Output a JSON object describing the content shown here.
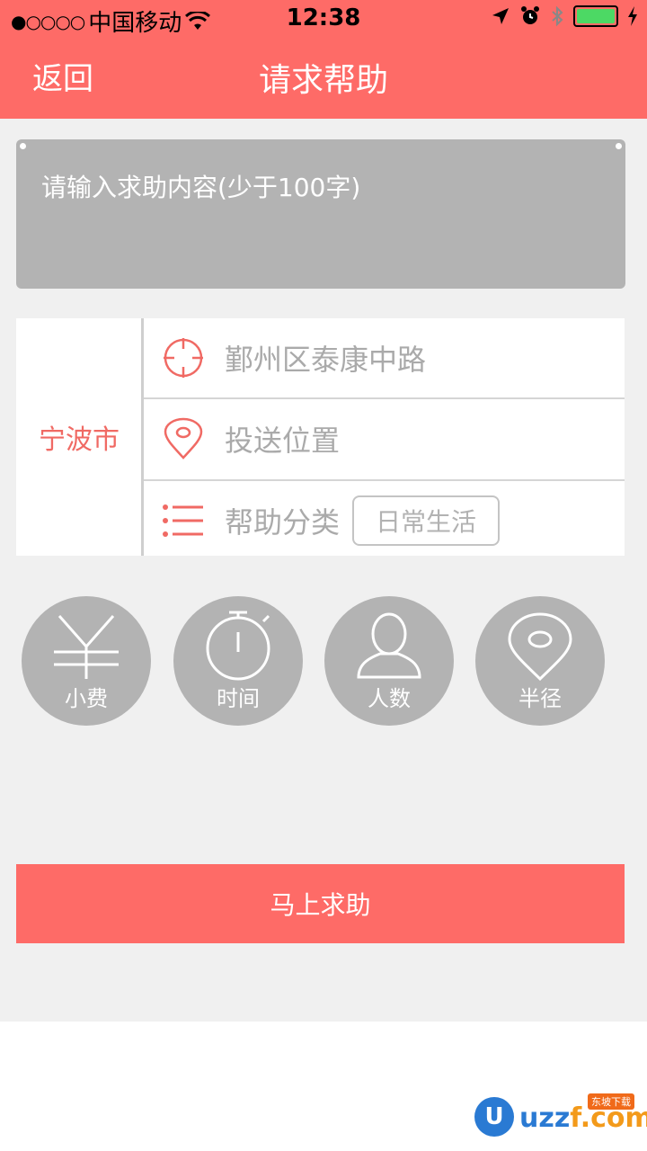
{
  "status_bar": {
    "signal": "●○○○○",
    "carrier": "中国移动",
    "time": "12:38",
    "battery_level": 1.0
  },
  "nav": {
    "back_label": "返回",
    "title": "请求帮助"
  },
  "help_content": {
    "placeholder": "请输入求助内容(少于100字)"
  },
  "location": {
    "city": "宁波市",
    "address": "鄞州区泰康中路",
    "delivery_label": "投送位置",
    "category_label": "帮助分类",
    "category_value": "日常生活"
  },
  "options": [
    {
      "label": "小费",
      "icon": "yuan-icon"
    },
    {
      "label": "时间",
      "icon": "stopwatch-icon"
    },
    {
      "label": "人数",
      "icon": "person-icon"
    },
    {
      "label": "半径",
      "icon": "location-pin-icon"
    }
  ],
  "submit_label": "马上求助",
  "watermark": {
    "logo_letter": "U",
    "brand_a": "uzz",
    "brand_b": "f.com",
    "tagline": "东坡下载"
  },
  "colors": {
    "accent": "#fe6b67",
    "panel_gray": "#b3b3b3",
    "city_red": "#f06a64"
  }
}
